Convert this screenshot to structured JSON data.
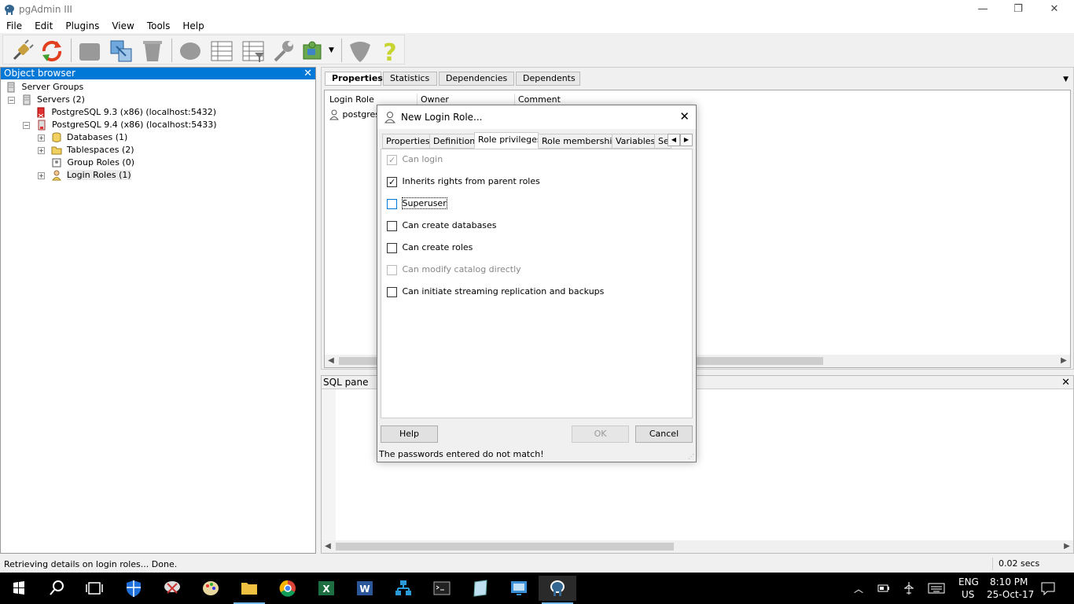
{
  "window": {
    "title": "pgAdmin III",
    "minimize": "—",
    "restore": "❐",
    "close": "✕"
  },
  "menu": [
    "File",
    "Edit",
    "Plugins",
    "View",
    "Tools",
    "Help"
  ],
  "object_browser": {
    "title": "Object browser",
    "close": "✕",
    "tree": [
      {
        "label": "Server Groups",
        "expander": ""
      },
      {
        "label": "Servers (2)",
        "expander": "−"
      },
      {
        "label": "PostgreSQL 9.3 (x86) (localhost:5432)",
        "expander": ""
      },
      {
        "label": "PostgreSQL 9.4 (x86) (localhost:5433)",
        "expander": "−"
      },
      {
        "label": "Databases (1)",
        "expander": "+"
      },
      {
        "label": "Tablespaces (2)",
        "expander": "+"
      },
      {
        "label": "Group Roles (0)",
        "expander": ""
      },
      {
        "label": "Login Roles (1)",
        "expander": "+"
      }
    ]
  },
  "properties_panel": {
    "tabs": [
      "Properties",
      "Statistics",
      "Dependencies",
      "Dependents"
    ],
    "dropdown": "▼",
    "columns": [
      "Login Role",
      "Owner",
      "Comment"
    ],
    "rows": [
      {
        "login_role": "postgres"
      }
    ]
  },
  "sql_pane": {
    "title": "SQL pane",
    "close": "✕"
  },
  "dialog": {
    "title": "New Login Role...",
    "close": "✕",
    "tabs": [
      "Properties",
      "Definition",
      "Role privileges",
      "Role membership",
      "Variables",
      "Se"
    ],
    "active_tab": "Role privileges",
    "tab_left": "◀",
    "tab_right": "▶",
    "options": [
      {
        "label": "Can login",
        "checked": true,
        "disabled": true
      },
      {
        "label": "Inherits rights from parent roles",
        "checked": true,
        "disabled": false
      },
      {
        "label": "Superuser",
        "checked": false,
        "disabled": false
      },
      {
        "label": "Can create databases",
        "checked": false,
        "disabled": false
      },
      {
        "label": "Can create roles",
        "checked": false,
        "disabled": false
      },
      {
        "label": "Can modify catalog directly",
        "checked": false,
        "disabled": true
      },
      {
        "label": "Can initiate streaming replication and backups",
        "checked": false,
        "disabled": false
      }
    ],
    "buttons": {
      "help": "Help",
      "ok": "OK",
      "cancel": "Cancel"
    },
    "status": "The passwords entered do not match!"
  },
  "status_bar": {
    "message": "Retrieving details on login roles... Done.",
    "timing": "0.02 secs"
  },
  "taskbar": {
    "lang": "ENG",
    "region": "US",
    "time": "8:10 PM",
    "date": "25-Oct-17"
  }
}
